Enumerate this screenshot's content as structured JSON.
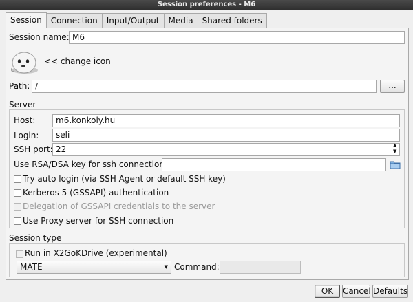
{
  "window": {
    "title": "Session preferences - M6"
  },
  "tabs": [
    {
      "label": "Session",
      "active": true
    },
    {
      "label": "Connection"
    },
    {
      "label": "Input/Output"
    },
    {
      "label": "Media"
    },
    {
      "label": "Shared folders"
    }
  ],
  "session": {
    "name_label": "Session name:",
    "name_value": "M6",
    "change_icon_label": "<< change icon",
    "path_label": "Path:",
    "path_value": "/",
    "browse_label": "..."
  },
  "server": {
    "group_label": "Server",
    "host_label": "Host:",
    "host_value": "m6.konkoly.hu",
    "login_label": "Login:",
    "login_value": "seli",
    "ssh_port_label": "SSH port:",
    "ssh_port_value": "22",
    "rsa_label": "Use RSA/DSA key for ssh connection:",
    "rsa_value": "",
    "auto_login_label": "Try auto login (via SSH Agent or default SSH key)",
    "kerberos_label": "Kerberos 5 (GSSAPI) authentication",
    "delegation_label": "Delegation of GSSAPI credentials to the server",
    "proxy_label": "Use Proxy server for SSH connection"
  },
  "session_type": {
    "group_label": "Session type",
    "run_label": "Run in X2GoKDrive (experimental)",
    "type_value": "MATE",
    "command_label": "Command:",
    "command_value": ""
  },
  "buttons": {
    "ok": "OK",
    "cancel": "Cancel",
    "defaults": "Defaults"
  }
}
